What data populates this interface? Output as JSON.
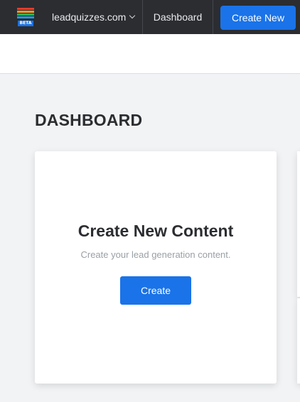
{
  "topbar": {
    "logo_badge": "BETA",
    "logo_icon": "stacked-color-bars-logo",
    "site_name": "leadquizzes.com",
    "site_dropdown_icon": "chevron-down-icon",
    "nav_dashboard": "Dashboard",
    "create_new_label": "Create New"
  },
  "page": {
    "title": "DASHBOARD"
  },
  "create_card": {
    "title": "Create New Content",
    "subtitle": "Create your lead generation content.",
    "button_label": "Create"
  },
  "colors": {
    "topbar_bg": "#2b2d30",
    "accent": "#1a73e8",
    "page_bg": "#f2f3f5",
    "logo_bars": [
      "#e63b2e",
      "#f29c1f",
      "#2fae58",
      "#1a9bd7"
    ]
  }
}
